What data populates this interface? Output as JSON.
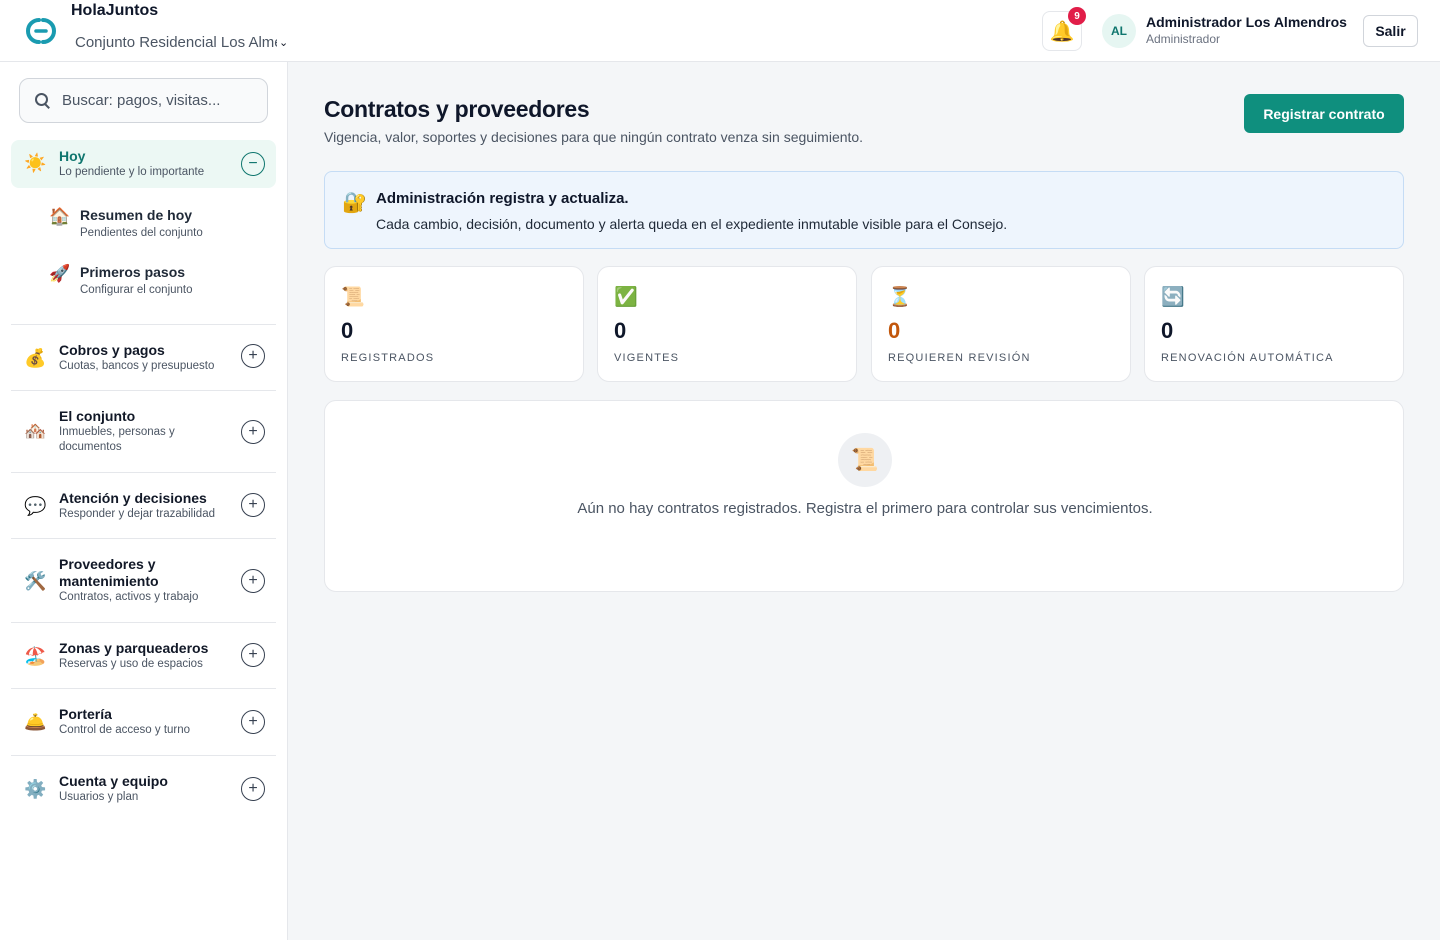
{
  "header": {
    "brand": "HolaJuntos",
    "org_select": "Conjunto Residencial Los Almendros",
    "notifications_count": "9",
    "user_initials": "AL",
    "user_name": "Administrador Los Almendros",
    "user_role": "Administrador",
    "logout_label": "Salir",
    "brand_color": "#1a9bb0"
  },
  "sidebar": {
    "search_placeholder": "Buscar: pagos, visitas...",
    "active_section": {
      "icon": "sun-icon",
      "emoji": "☀️",
      "title": "Hoy",
      "subtitle": "Lo pendiente y lo importante",
      "toggle": "−",
      "children": [
        {
          "icon": "house-icon",
          "emoji": "🏠",
          "title": "Resumen de hoy",
          "subtitle": "Pendientes del conjunto"
        },
        {
          "icon": "rocket-icon",
          "emoji": "🚀",
          "title": "Primeros pasos",
          "subtitle": "Configurar el conjunto"
        }
      ]
    },
    "sections": [
      {
        "icon": "money-bag-icon",
        "emoji": "💰",
        "title": "Cobros y pagos",
        "subtitle": "Cuotas, bancos y presupuesto",
        "toggle": "+"
      },
      {
        "icon": "houses-icon",
        "emoji": "🏘️",
        "title": "El conjunto",
        "subtitle_line1": "Inmuebles, personas y",
        "subtitle_line2": "documentos",
        "toggle": "+"
      },
      {
        "icon": "speech-bubble-icon",
        "emoji": "💬",
        "title": "Atención y decisiones",
        "subtitle": "Responder y dejar trazabilidad",
        "toggle": "+"
      },
      {
        "icon": "tools-icon",
        "emoji": "🛠️",
        "title_line1": "Proveedores y",
        "title_line2": "mantenimiento",
        "subtitle": "Contratos, activos y trabajo",
        "toggle": "+"
      },
      {
        "icon": "beach-icon",
        "emoji": "🏖️",
        "title": "Zonas y parqueaderos",
        "subtitle": "Reservas y uso de espacios",
        "toggle": "+"
      },
      {
        "icon": "bell-service-icon",
        "emoji": "🛎️",
        "title": "Portería",
        "subtitle": "Control de acceso y turno",
        "toggle": "+"
      },
      {
        "icon": "gear-icon",
        "emoji": "⚙️",
        "title": "Cuenta y equipo",
        "subtitle": "Usuarios y plan",
        "toggle": "+"
      }
    ]
  },
  "main": {
    "title": "Contratos y proveedores",
    "subtitle": "Vigencia, valor, soportes y decisiones para que ningún contrato venza sin seguimiento.",
    "primary_action": "Registrar contrato",
    "notice": {
      "icon": "lock-key-icon",
      "emoji": "🔐",
      "title": "Administración registra y actualiza.",
      "text": "Cada cambio, decisión, documento y alerta queda en el expediente inmutable visible para el Consejo."
    },
    "stats": [
      {
        "icon": "scroll-icon",
        "emoji": "📜",
        "value": "0",
        "label": "REGISTRADOS"
      },
      {
        "icon": "check-mark-icon",
        "emoji": "✅",
        "value": "0",
        "label": "VIGENTES"
      },
      {
        "icon": "hourglass-icon",
        "emoji": "⏳",
        "value": "0",
        "label": "REQUIEREN REVISIÓN",
        "value_color": "#c2570c"
      },
      {
        "icon": "refresh-icon",
        "emoji": "🔄",
        "value": "0",
        "label": "RENOVACIÓN AUTOMÁTICA"
      }
    ],
    "empty_state": {
      "icon": "scroll-icon",
      "emoji": "📜",
      "text": "Aún no hay contratos registrados. Registra el primero para controlar sus vencimientos."
    },
    "accent_color": "#0f8f7e"
  }
}
